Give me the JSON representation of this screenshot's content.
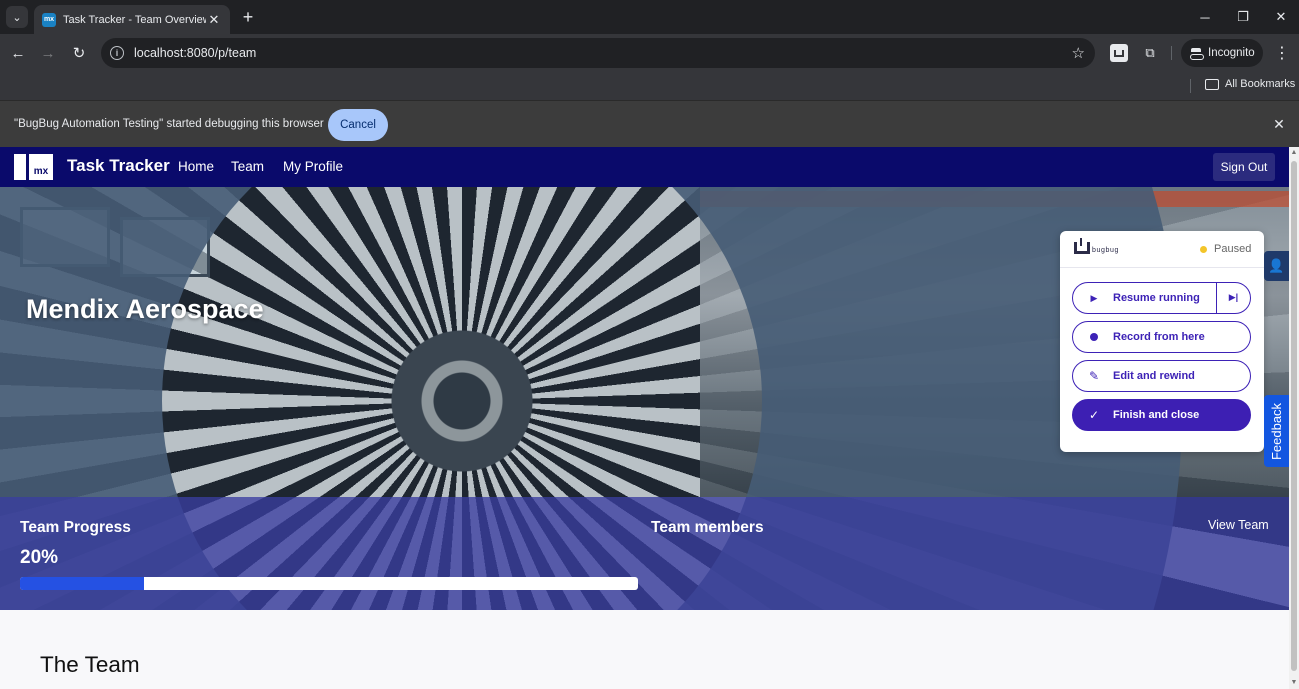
{
  "browser": {
    "tab_title": "Task Tracker - Team Overview",
    "tab_favicon_text": "mx",
    "url": "localhost:8080/p/team",
    "incognito_label": "Incognito",
    "bookmarks_label": "All Bookmarks",
    "infobar_text": "\"BugBug Automation Testing\" started debugging this browser",
    "infobar_cancel": "Cancel"
  },
  "app": {
    "logo_text": "mx",
    "brand": "Task Tracker",
    "nav": [
      "Home",
      "Team",
      "My Profile"
    ],
    "sign_out": "Sign Out"
  },
  "hero": {
    "title": "Mendix Aerospace"
  },
  "progress": {
    "label": "Team Progress",
    "value_text": "20%",
    "value": 0.2,
    "members_label": "Team members",
    "view_team": "View Team",
    "fill_color": "#2551e3"
  },
  "section": {
    "title": "The Team"
  },
  "bugbug": {
    "logo_text": "bugbug",
    "status": "Paused",
    "status_color": "#f3c52a",
    "buttons": {
      "resume": "Resume running",
      "record": "Record from here",
      "edit": "Edit and rewind",
      "finish": "Finish and close"
    },
    "accent": "#3d1fb3"
  },
  "side_widgets": {
    "feedback": "Feedback"
  },
  "icons": [
    "tab-search-icon",
    "close-icon",
    "plus-icon",
    "minimize-icon",
    "restore-icon",
    "back-icon",
    "forward-icon",
    "reload-icon",
    "info-icon",
    "star-icon",
    "bugbug-extension-icon",
    "puzzle-icon",
    "incognito-icon",
    "menu-dots-icon",
    "folder-icon",
    "play-icon",
    "skip-icon",
    "record-icon",
    "edit-rewind-icon",
    "check-icon",
    "person-icon"
  ]
}
